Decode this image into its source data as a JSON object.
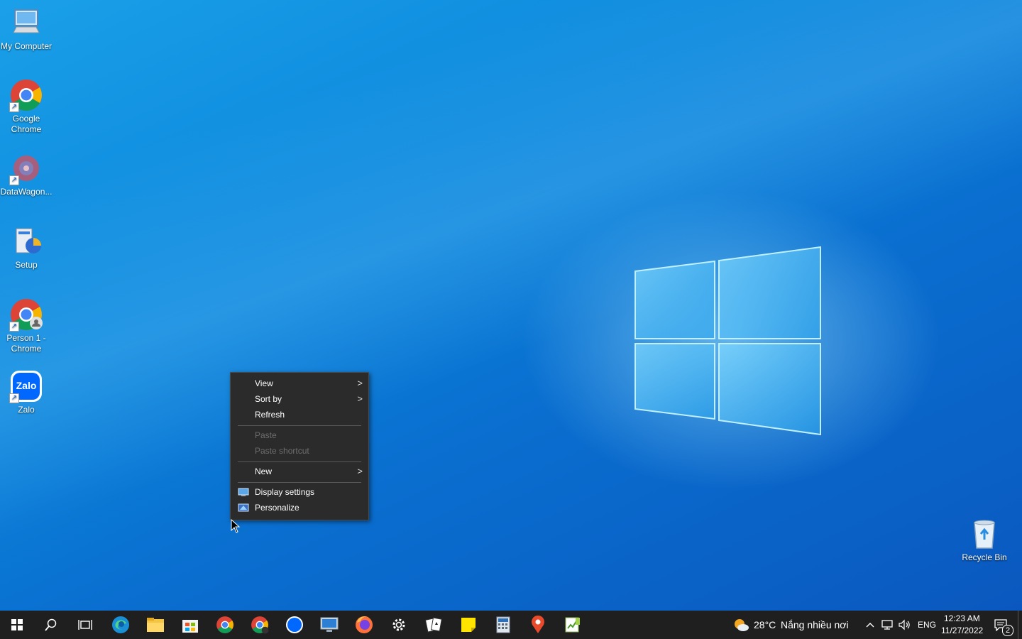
{
  "desktop_icons": [
    {
      "label": "My Computer"
    },
    {
      "label": "Google Chrome"
    },
    {
      "label": "DataWagon..."
    },
    {
      "label": "Setup"
    },
    {
      "label": "Person 1 - Chrome"
    },
    {
      "label": "Zalo"
    },
    {
      "label": "Recycle Bin"
    }
  ],
  "context_menu": {
    "view": "View",
    "sort_by": "Sort by",
    "refresh": "Refresh",
    "paste": "Paste",
    "paste_shortcut": "Paste shortcut",
    "new": "New",
    "display_settings": "Display settings",
    "personalize": "Personalize",
    "submenu_glyph": ">"
  },
  "taskbar": {
    "pinned": [
      "start-icon",
      "search-icon",
      "task-view-icon",
      "edge-icon",
      "file-explorer-icon",
      "store-icon",
      "chrome-icon",
      "chrome-profile-icon",
      "zalo-icon",
      "remote-desktop-icon",
      "firefox-icon",
      "settings-icon",
      "solitaire-icon",
      "sticky-notes-icon",
      "calculator-icon",
      "maps-icon",
      "notepad-plus-icon"
    ],
    "zalo_text": "Zalo",
    "weather_temp": "28°C",
    "weather_desc": "Nắng nhiều nơi",
    "language": "ENG",
    "time": "12:23 AM",
    "date": "11/27/2022",
    "notification_count": "2"
  },
  "colors": {
    "accent": "#0a78d7",
    "menu_bg": "#2b2b2b",
    "taskbar_bg": "#1f1f1f"
  }
}
